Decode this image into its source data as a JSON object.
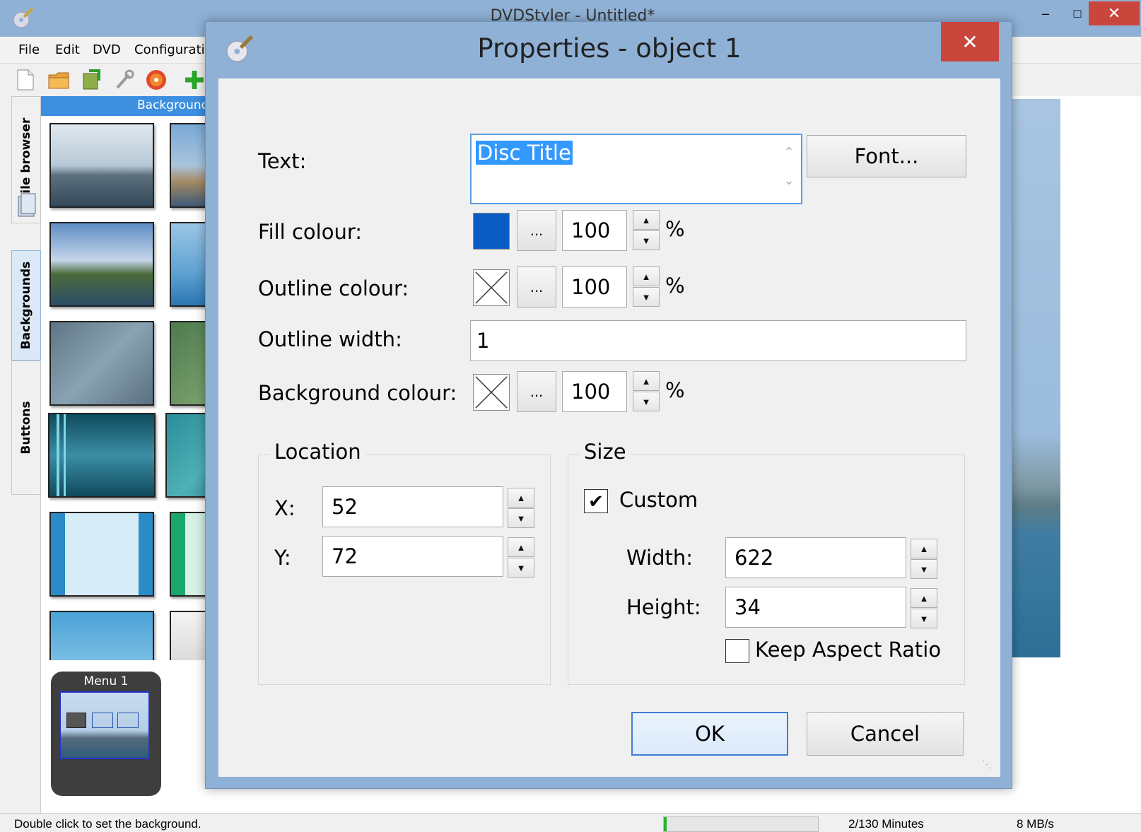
{
  "main_window": {
    "title": "DVDStyler - Untitled*",
    "menu": [
      "File",
      "Edit",
      "DVD",
      "Configurati"
    ],
    "side_tabs": [
      "File browser",
      "Backgrounds",
      "Buttons"
    ],
    "panel_header": "Backgrounds",
    "menu_thumbnail_label": "Menu 1",
    "status": {
      "hint": "Double click to set the background.",
      "gauge_fraction": 0.02,
      "duration": "2/130 Minutes",
      "rate": "8 MB/s"
    }
  },
  "dialog": {
    "title": "Properties - object 1",
    "close_glyph": "✕",
    "text_label": "Text:",
    "text_value": "Disc Title",
    "font_button": "Font...",
    "fill_label": "Fill colour:",
    "fill_color": "#0a5cc4",
    "fill_opacity": "100",
    "outline_label": "Outline colour:",
    "outline_opacity": "100",
    "outline_width_label": "Outline width:",
    "outline_width_value": "1",
    "background_label": "Background colour:",
    "background_opacity": "100",
    "ellipsis": "...",
    "percent": "%",
    "location": {
      "title": "Location",
      "x_label": "X:",
      "x_value": "52",
      "y_label": "Y:",
      "y_value": "72"
    },
    "size": {
      "title": "Size",
      "custom_label": "Custom",
      "custom_checked": true,
      "width_label": "Width:",
      "width_value": "622",
      "height_label": "Height:",
      "height_value": "34",
      "keep_aspect_label": "Keep Aspect Ratio",
      "keep_aspect_checked": false
    },
    "ok_button": "OK",
    "cancel_button": "Cancel"
  }
}
